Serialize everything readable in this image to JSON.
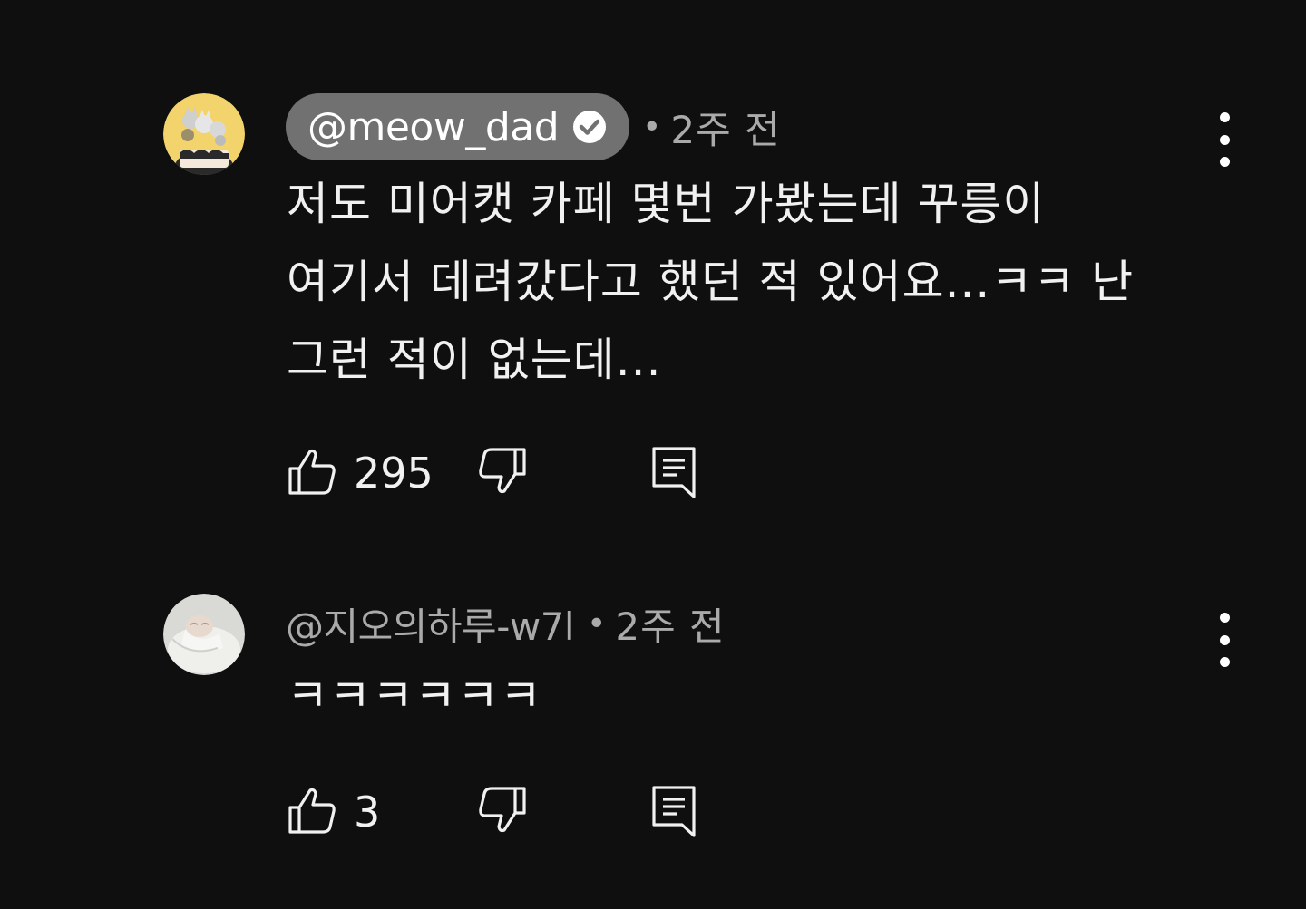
{
  "comments": [
    {
      "author": "@meow_dad",
      "verified": true,
      "separator": "•",
      "time": "2주 전",
      "text_lines": [
        "저도 미어캣 카페 몇번 가봤는데 꾸릉이",
        "여기서 데려갔다고 했던 적 있어요...ㅋㅋ 난",
        "그런 적이 없는데..."
      ],
      "likes": "295",
      "avatar_icon": "cats-cartoon-avatar",
      "avatar_bg": "#f3d36b"
    },
    {
      "author": "@지오의하루-w7l",
      "verified": false,
      "separator": "•",
      "time": "2주 전",
      "text_lines": [
        "ㅋㅋㅋㅋㅋㅋ"
      ],
      "likes": "3",
      "avatar_icon": "baby-photo-avatar",
      "avatar_bg": "#d9d9d6"
    }
  ],
  "colors": {
    "background": "#0f0f0f",
    "pill": "#717171",
    "secondary_text": "#aaaaaa",
    "primary_text": "#f1f1f1"
  }
}
